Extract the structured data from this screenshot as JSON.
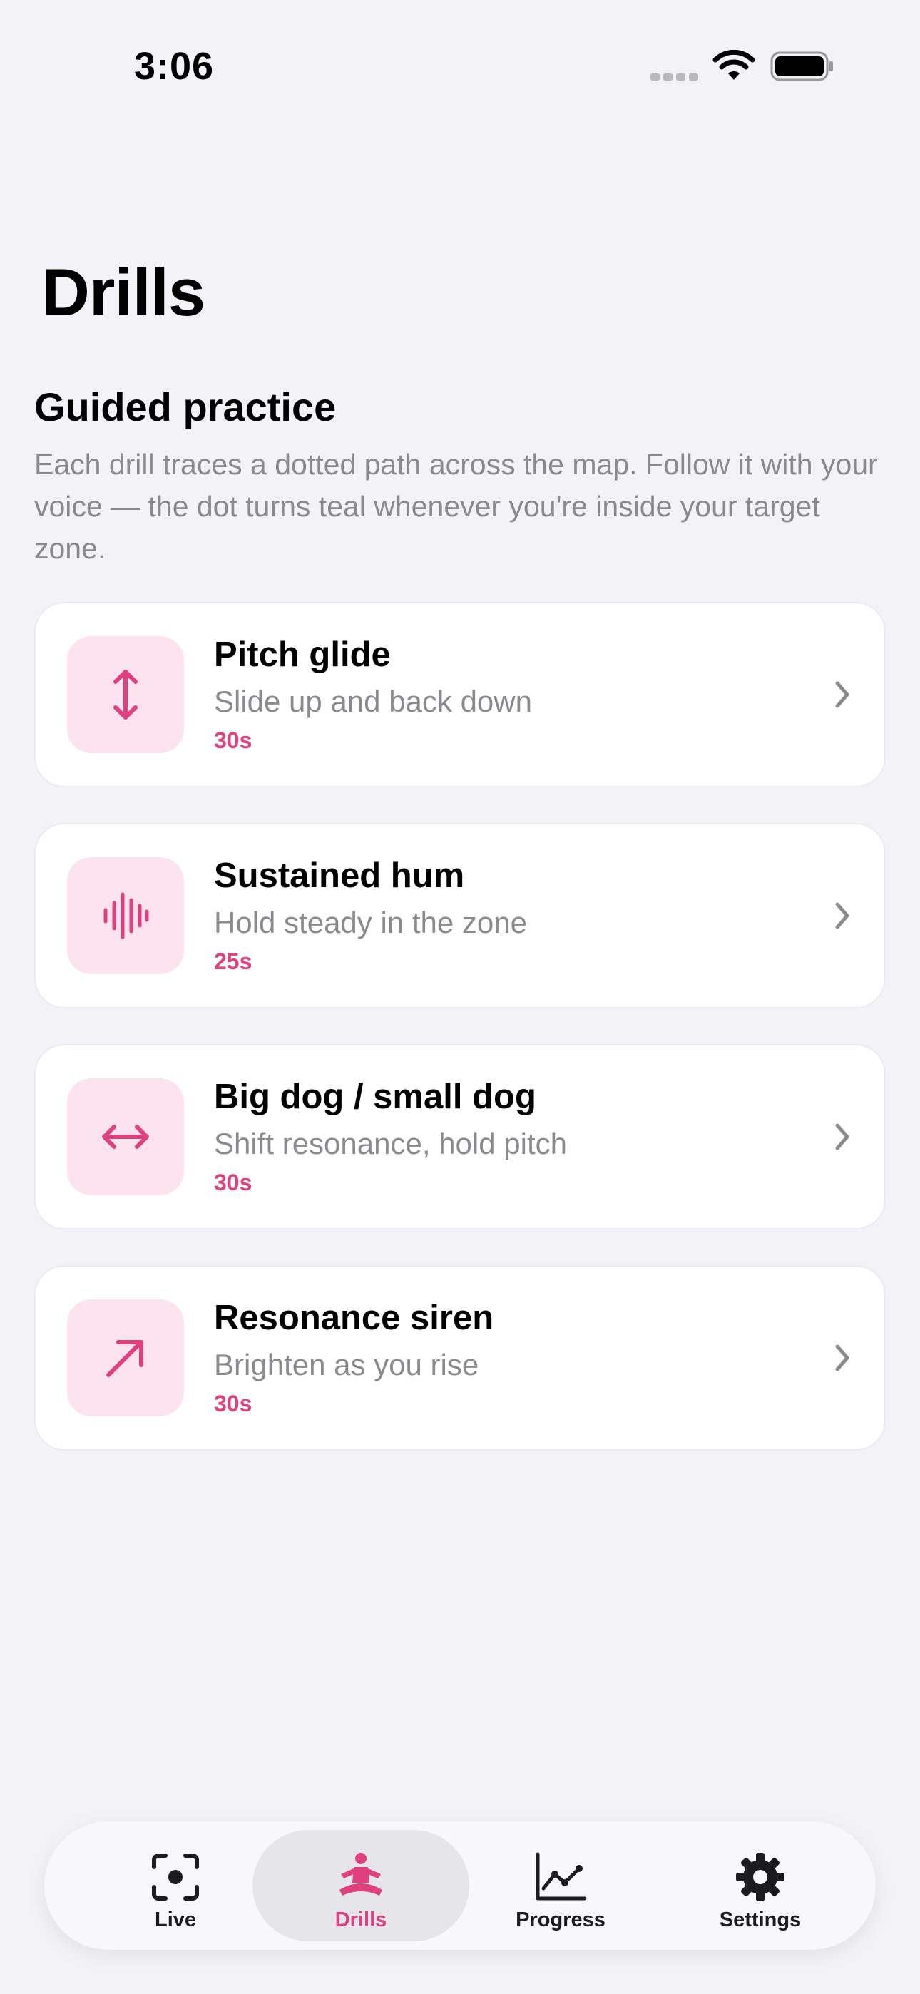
{
  "status_bar": {
    "time": "3:06"
  },
  "page": {
    "title": "Drills"
  },
  "section": {
    "title": "Guided practice",
    "description": "Each drill traces a dotted path across the map. Follow it with your voice — the dot turns teal whenever you're inside your target zone."
  },
  "drills": [
    {
      "icon": "vertical-arrows-icon",
      "title": "Pitch glide",
      "subtitle": "Slide up and back down",
      "duration": "30s"
    },
    {
      "icon": "waveform-icon",
      "title": "Sustained hum",
      "subtitle": "Hold steady in the zone",
      "duration": "25s"
    },
    {
      "icon": "horizontal-arrows-icon",
      "title": "Big dog / small dog",
      "subtitle": "Shift resonance, hold pitch",
      "duration": "30s"
    },
    {
      "icon": "arrow-up-right-icon",
      "title": "Resonance siren",
      "subtitle": "Brighten as you rise",
      "duration": "30s"
    }
  ],
  "tabs": [
    {
      "label": "Live",
      "icon": "camera-viewfinder-icon",
      "active": false
    },
    {
      "label": "Drills",
      "icon": "meditation-figure-icon",
      "active": true
    },
    {
      "label": "Progress",
      "icon": "line-chart-icon",
      "active": false
    },
    {
      "label": "Settings",
      "icon": "gear-icon",
      "active": false
    }
  ],
  "colors": {
    "accent": "#e0407e",
    "icon_bg": "#fce3ee",
    "background": "#f2f2f7"
  }
}
